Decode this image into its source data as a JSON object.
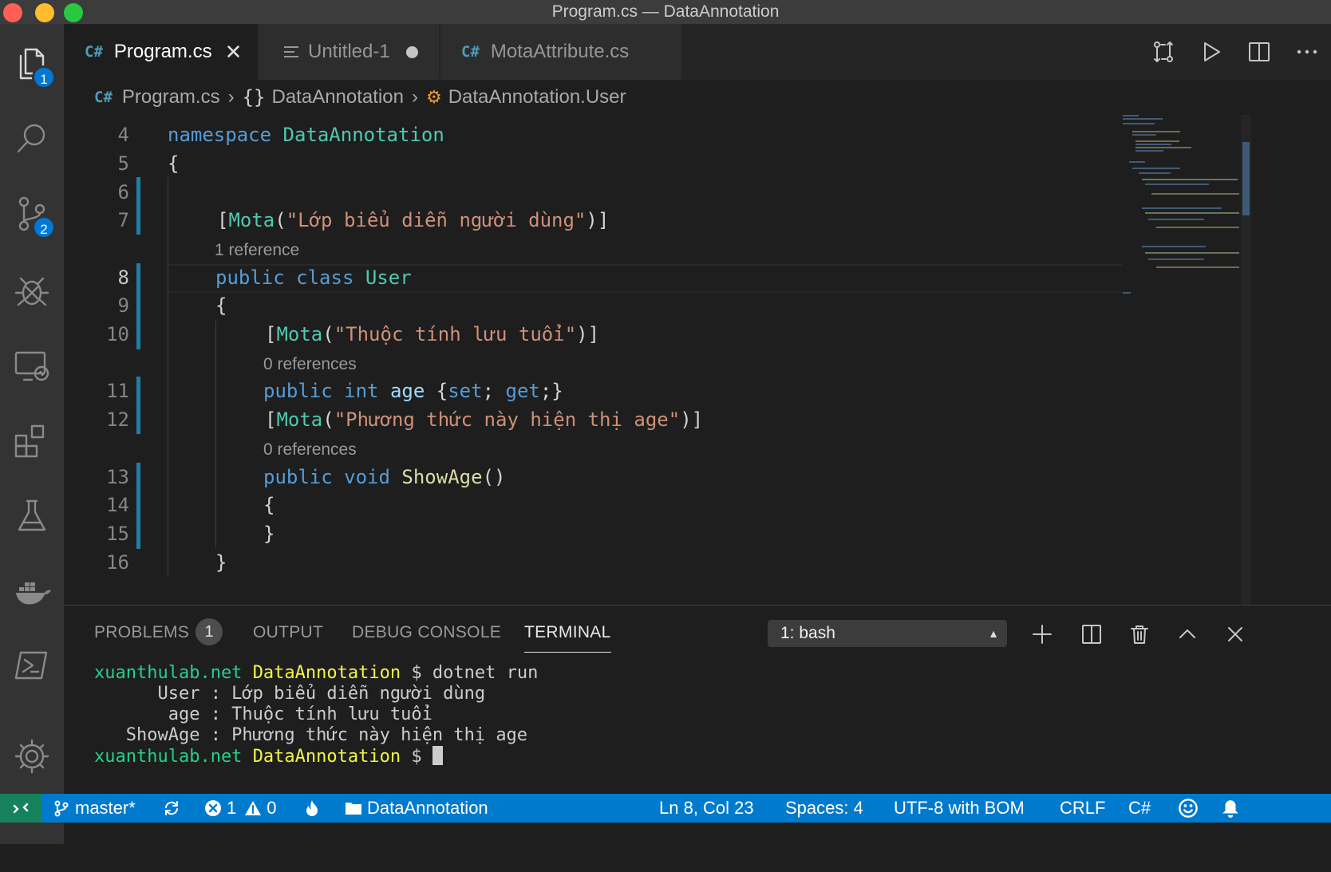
{
  "window": {
    "title": "Program.cs — DataAnnotation"
  },
  "activity": {
    "explorer_badge": "1",
    "scm_badge": "2"
  },
  "tabs": [
    {
      "label": "Program.cs",
      "icon": "C#"
    },
    {
      "label": "Untitled-1"
    },
    {
      "label": "MotaAttribute.cs",
      "icon": "C#"
    }
  ],
  "breadcrumb": {
    "file": "Program.cs",
    "namespace": "DataAnnotation",
    "class": "DataAnnotation.User",
    "ns_icon": "{}",
    "cs_icon": "C#"
  },
  "editor": {
    "line_numbers": [
      "4",
      "5",
      "6",
      "7",
      "8",
      "9",
      "10",
      "11",
      "12",
      "13",
      "14",
      "15",
      "16"
    ],
    "lenses": [
      "1 reference",
      "0 references",
      "0 references"
    ],
    "code": {
      "l4_kw": "namespace",
      "l4_name": "DataAnnotation",
      "l5": "{",
      "l7_open": "[",
      "l7_attr": "Mota",
      "l7_paren": "(",
      "l7_str": "\"Lớp biểu diễn người dùng\"",
      "l7_close": ")]",
      "l8_kw1": "public",
      "l8_kw2": "class",
      "l8_name": "User",
      "l9": "{",
      "l10_open": "[",
      "l10_attr": "Mota",
      "l10_paren": "(",
      "l10_str": "\"Thuộc tính lưu tuổi\"",
      "l10_close": ")]",
      "l11_kw1": "public",
      "l11_kw2": "int",
      "l11_name": "age",
      "l11_b1": "{",
      "l11_set": "set",
      "l11_semi": ";",
      "l11_get": "get",
      "l11_b2": ";}",
      "l12_open": "[",
      "l12_attr": "Mota",
      "l12_paren": "(",
      "l12_str": "\"Phương thức này hiện thị age\"",
      "l12_close": ")]",
      "l13_kw1": "public",
      "l13_kw2": "void",
      "l13_name": "ShowAge",
      "l13_paren": "()",
      "l14": "{",
      "l15": "}",
      "l16": "}"
    }
  },
  "panel": {
    "tabs": [
      "PROBLEMS",
      "OUTPUT",
      "DEBUG CONSOLE",
      "TERMINAL"
    ],
    "problems_count": "1",
    "terminal_select": "1: bash",
    "terminal": {
      "prompt_host": "xuanthulab.net",
      "prompt_dir": "DataAnnotation",
      "prompt_sym": "$",
      "command": "dotnet run",
      "out1": "      User : Lớp biểu diễn người dùng",
      "out2": "       age : Thuộc tính lưu tuổi",
      "out3": "   ShowAge : Phương thức này hiện thị age"
    }
  },
  "statusbar": {
    "branch": "master*",
    "errors": "1",
    "warnings": "0",
    "folder": "DataAnnotation",
    "position": "Ln 8, Col 23",
    "spaces": "Spaces: 4",
    "encoding": "UTF-8 with BOM",
    "eol": "CRLF",
    "language": "C#"
  },
  "colors": {
    "accent": "#007acc",
    "remote": "#16825d",
    "keyword": "#569cd6",
    "type": "#4ec9b0",
    "string": "#ce9178",
    "function": "#dcdcaa",
    "variable": "#9cdcfe"
  }
}
